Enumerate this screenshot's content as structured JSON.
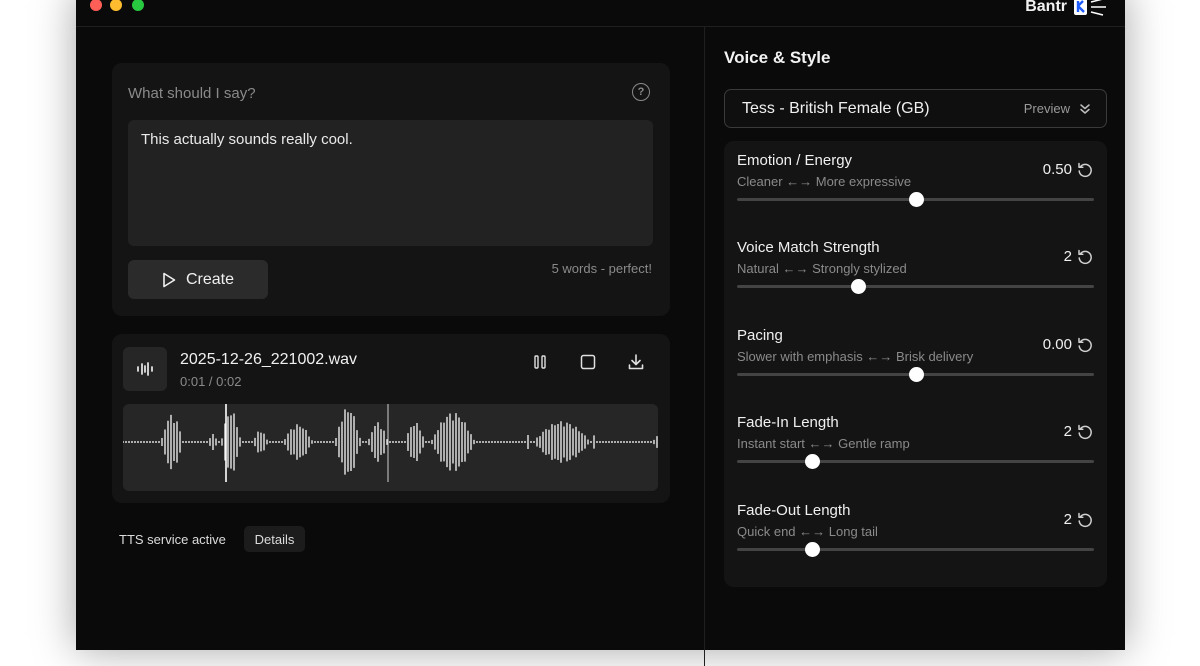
{
  "app": {
    "brand": "Bantr"
  },
  "prompt": {
    "title": "What should I say?",
    "text": "This actually sounds really cool.",
    "create_label": "Create",
    "word_count": "5 words - perfect!"
  },
  "player": {
    "file_name": "2025-12-26_221002.wav",
    "time": "0:01 / 0:02"
  },
  "status": {
    "text": "TTS service active",
    "details_label": "Details"
  },
  "panel": {
    "title": "Voice & Style",
    "voice": "Tess - British Female (GB)",
    "preview_label": "Preview"
  },
  "sliders": [
    {
      "label": "Emotion / Energy",
      "sub": "Cleaner ←→ More expressive",
      "value": "0.50",
      "position": 0.5
    },
    {
      "label": "Voice Match Strength",
      "sub": "Natural ←→ Strongly stylized",
      "value": "2",
      "position": 0.34
    },
    {
      "label": "Pacing",
      "sub": "Slower with emphasis ←→ Brisk delivery",
      "value": "0.00",
      "position": 0.5
    },
    {
      "label": "Fade-In Length",
      "sub": "Instant start ←→ Gentle ramp",
      "value": "2",
      "position": 0.21
    },
    {
      "label": "Fade-Out Length",
      "sub": "Quick end ←→ Long tail",
      "value": "2",
      "position": 0.21
    }
  ],
  "colors": {
    "accent": "#ffffff",
    "background": "#0a0a0a",
    "card": "#141414"
  }
}
